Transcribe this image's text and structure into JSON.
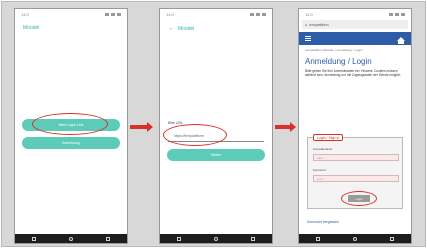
{
  "screens": [
    {
      "status_time": "14:0",
      "app_title": "Moodel",
      "buttons": [
        "Mein Login-Link",
        "Anmeldung"
      ]
    },
    {
      "status_time": "14:0",
      "app_title": "Moodel",
      "input_label": "Bitte URL",
      "input_value": "https://lernplattform",
      "button": "Weiter"
    },
    {
      "status_time": "14:0",
      "url": "lernplattform",
      "breadcrumb": "Lernplattform Moodle > Anmeldung > Login",
      "heading": "Anmeldung / Login",
      "intro": "Bitte geben Sie Ihre Anmeldedaten ein. Hinweis: Cookies müssen aktiviert sein. Anmeldung nur mit Zugangsdaten der Schule möglich.",
      "login_tag": "Login / Sign In",
      "username_label": "Anmeldename",
      "username_value": "user",
      "password_label": "Kennwort",
      "password_value": "••••••",
      "submit": "Login",
      "forgot": "Kennwort vergessen"
    }
  ]
}
